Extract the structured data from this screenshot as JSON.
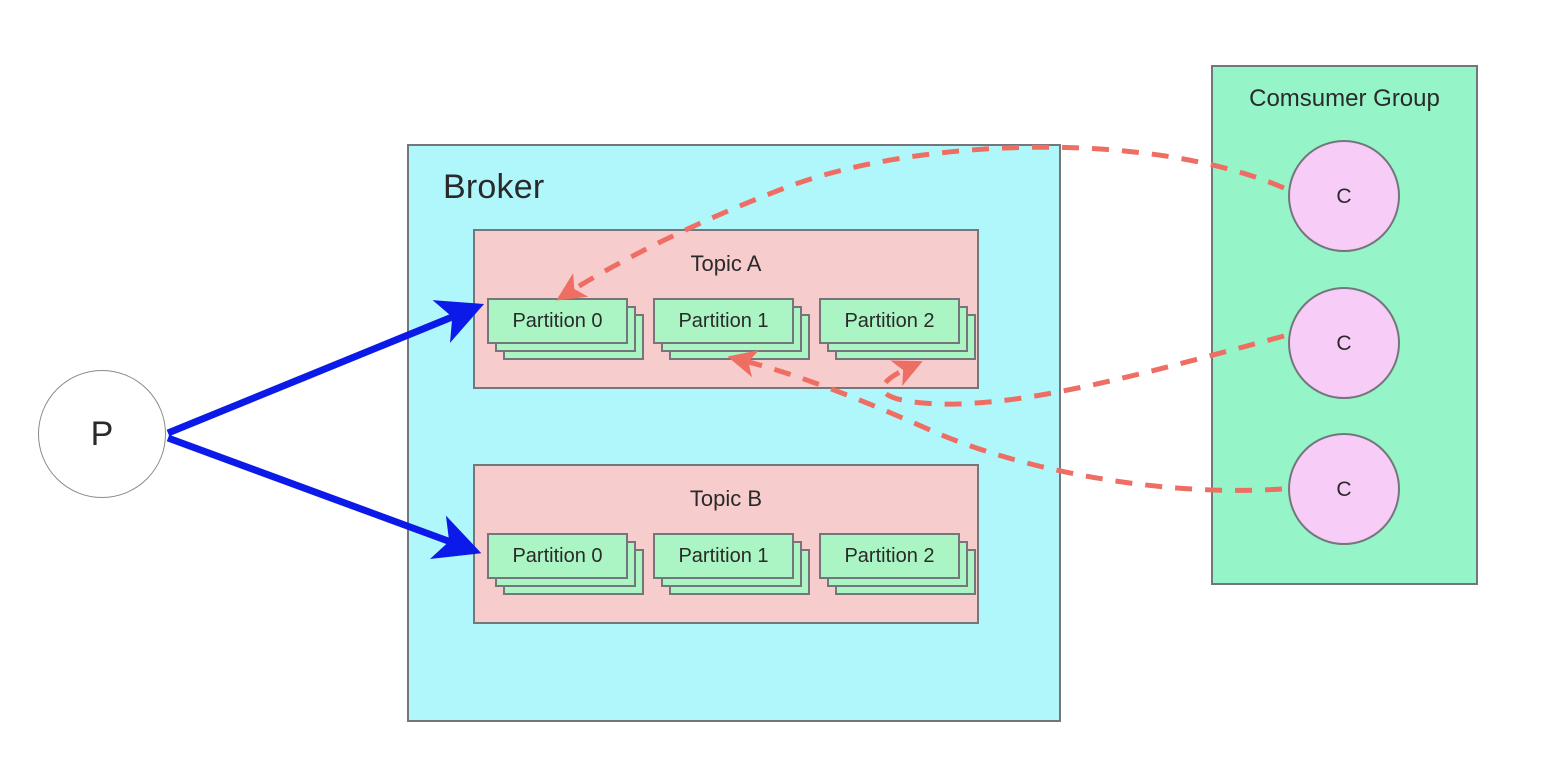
{
  "diagram": {
    "title": "Kafka producer broker consumer group diagram",
    "colors": {
      "broker_fill": "#b0f7fc",
      "topic_fill": "#f7cccc",
      "partition_fill": "#aaf5c3",
      "consumer_group_fill": "#95f5c8",
      "consumer_fill": "#f7ccf7",
      "producer_fill": "#ffffff",
      "produce_arrow": "#0b1ae8",
      "consume_arrow": "#ef6e63",
      "stroke": "#73777b"
    }
  },
  "producer": {
    "label": "P"
  },
  "broker": {
    "label": "Broker",
    "topics": [
      {
        "label": "Topic A",
        "partitions": [
          {
            "label": "Partition 0"
          },
          {
            "label": "Partition 1"
          },
          {
            "label": "Partition 2"
          }
        ]
      },
      {
        "label": "Topic B",
        "partitions": [
          {
            "label": "Partition 0"
          },
          {
            "label": "Partition 1"
          },
          {
            "label": "Partition 2"
          }
        ]
      }
    ]
  },
  "consumer_group": {
    "label": "Comsumer Group",
    "consumers": [
      {
        "label": "C"
      },
      {
        "label": "C"
      },
      {
        "label": "C"
      }
    ]
  },
  "edges": {
    "produce": [
      {
        "from": "producer",
        "to": "topic-a-partition-0"
      },
      {
        "from": "producer",
        "to": "topic-b-partition-0"
      }
    ],
    "consume": [
      {
        "from": "consumer-0",
        "to": "topic-a-partition-0"
      },
      {
        "from": "consumer-1",
        "to": "topic-a-partition-2"
      },
      {
        "from": "consumer-2",
        "to": "topic-a-partition-1"
      }
    ]
  }
}
